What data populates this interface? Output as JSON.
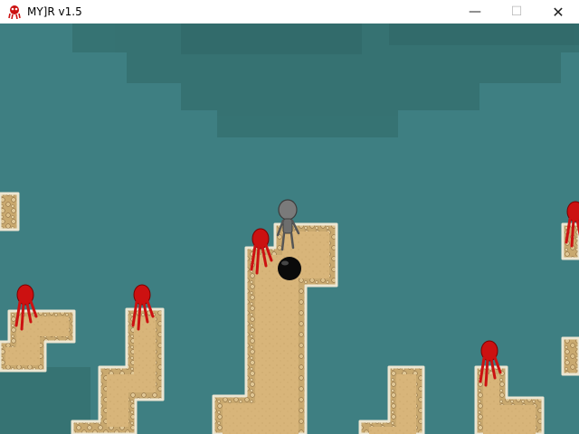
{
  "window": {
    "title": "MY]R v1.5",
    "minimize_glyph": "—",
    "maximize_glyph": "☐",
    "close_glyph": "✕",
    "app_icon": "red-squid-icon"
  },
  "game": {
    "water_color": "#3e7f82",
    "water_dark": "#35706f",
    "sand_color": "#d8b57a",
    "sand_border": "#9c7a47",
    "enemy_color": "#cc1111",
    "player_color": "#7a7a7a",
    "ball_color": "#0a0a0a",
    "entities": {
      "player": "grey-humanoid-player",
      "enemies": "red-squid-enemies",
      "ball": "black-ball"
    }
  }
}
